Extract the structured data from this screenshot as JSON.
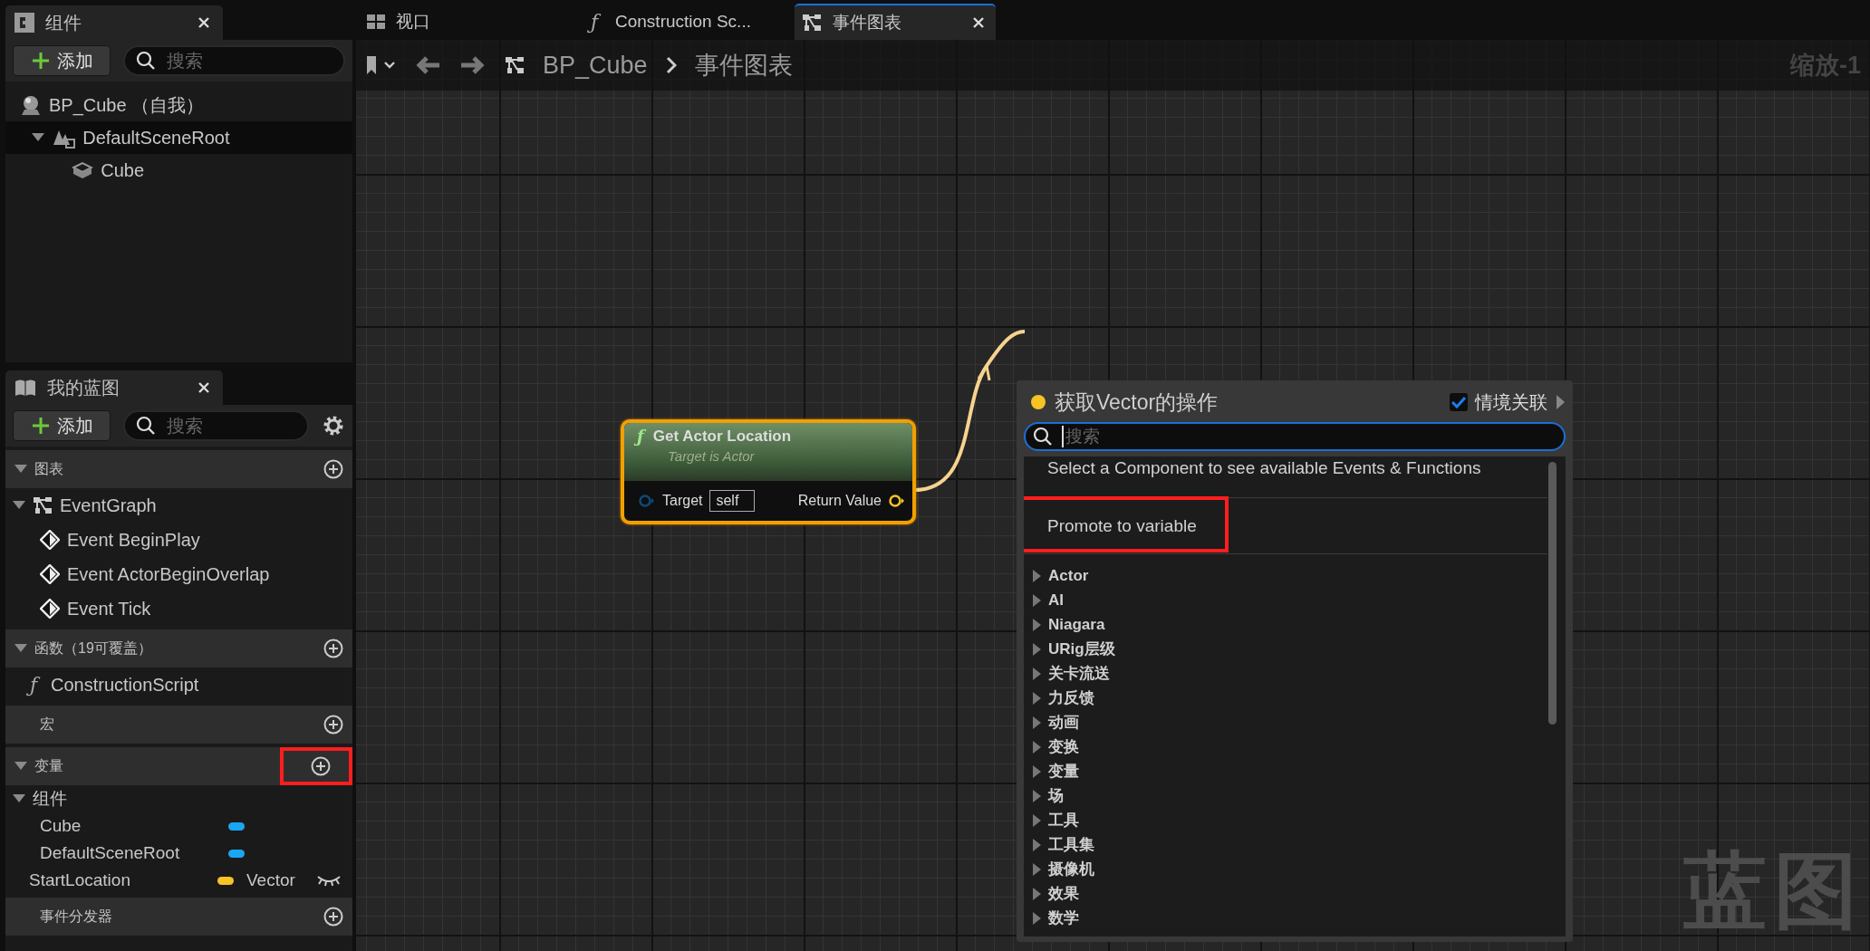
{
  "components_panel": {
    "tab": {
      "title": "组件"
    },
    "add_button": "添加",
    "search": {
      "placeholder": "搜索"
    },
    "tree": [
      {
        "label": "BP_Cube （自我）",
        "kind": "actor",
        "selected": false
      },
      {
        "label": "DefaultSceneRoot",
        "kind": "scene",
        "selected": true,
        "expanded": true,
        "children": [
          {
            "label": "Cube",
            "kind": "mesh",
            "selected": false
          }
        ]
      }
    ]
  },
  "my_blueprint": {
    "tab": {
      "title": "我的蓝图"
    },
    "add_button": "添加",
    "search": {
      "placeholder": "搜索"
    },
    "sections": [
      {
        "title": "图表",
        "expanded": true,
        "highlighted": false,
        "items": [
          {
            "kind": "graph",
            "label": "EventGraph",
            "expanded": true,
            "children": [
              {
                "kind": "event",
                "label": "Event BeginPlay"
              },
              {
                "kind": "event",
                "label": "Event ActorBeginOverlap"
              },
              {
                "kind": "event",
                "label": "Event Tick"
              }
            ]
          }
        ]
      },
      {
        "title": "函数（19可覆盖）",
        "expanded": true,
        "highlighted": false,
        "items": [
          {
            "kind": "function",
            "icon": "ƒ",
            "label": "ConstructionScript"
          }
        ]
      },
      {
        "title": "宏",
        "highlighted": false
      },
      {
        "title": "变量",
        "expanded": true,
        "highlighted": true,
        "items": [
          {
            "kind": "group",
            "label": "组件",
            "expanded": true,
            "children": [
              {
                "kind": "variable",
                "label": "Cube",
                "color": "#1aa6f2"
              },
              {
                "kind": "variable",
                "label": "DefaultSceneRoot",
                "color": "#1aa6f2"
              }
            ]
          },
          {
            "kind": "variable",
            "label": "StartLocation",
            "color": "#f7c325",
            "type": "Vector",
            "visible": false
          }
        ]
      },
      {
        "title": "事件分发器",
        "highlighted": false
      }
    ]
  },
  "graph": {
    "tabs": [
      {
        "label": "视口",
        "kind": "viewport",
        "selected": false,
        "closable": false
      },
      {
        "label": "Construction Sc...",
        "kind": "function",
        "icon": "ƒ",
        "selected": false,
        "closable": false
      },
      {
        "label": "事件图表",
        "kind": "graph",
        "selected": true,
        "closable": true
      }
    ],
    "breadcrumb": [
      "BP_Cube",
      "事件图表"
    ],
    "zoom_label": "缩放-1",
    "corner_label": "蓝图",
    "node": {
      "icon": "ƒ",
      "title": "Get Actor Location",
      "subtitle": "Target is Actor",
      "selected": true,
      "input": {
        "label": "Target",
        "value": "self"
      },
      "output": {
        "label": "Return Value",
        "color": "#f7c325",
        "connected": true
      }
    },
    "action_menu": {
      "title": "获取Vector的操作",
      "color": "#f7c325",
      "context": {
        "label": "情境关联",
        "checked": true
      },
      "search": {
        "placeholder": "搜索",
        "focused": true
      },
      "entries": [
        {
          "kind": "note",
          "text": "Select a Component to see available Events & Functions",
          "highlighted": false
        },
        {
          "kind": "action",
          "text": "Promote to variable",
          "highlighted": true
        }
      ],
      "categories": [
        {
          "label": "Actor"
        },
        {
          "label": "AI"
        },
        {
          "label": "Niagara"
        },
        {
          "label": "URig层级"
        },
        {
          "label": "关卡流送"
        },
        {
          "label": "力反馈"
        },
        {
          "label": "动画"
        },
        {
          "label": "变换"
        },
        {
          "label": "变量"
        },
        {
          "label": "场"
        },
        {
          "label": "工具"
        },
        {
          "label": "工具集"
        },
        {
          "label": "摄像机"
        },
        {
          "label": "效果"
        },
        {
          "label": "数学"
        }
      ]
    }
  }
}
